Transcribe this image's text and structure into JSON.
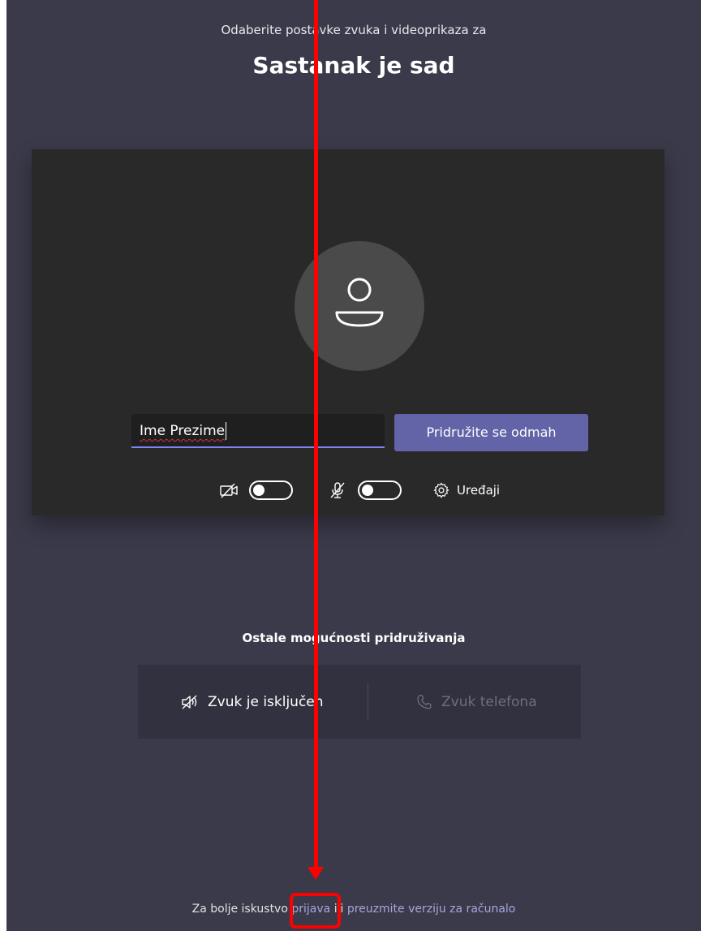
{
  "header": {
    "subtitle": "Odaberite postavke zvuka i videoprikaza za",
    "meeting_title": "Sastanak je sad"
  },
  "preview": {
    "avatar_icon": "person-icon",
    "name_value": "Ime Prezime",
    "join_button_label": "Pridružite se odmah"
  },
  "controls": {
    "camera_icon": "camera-off-icon",
    "camera_on": false,
    "mic_icon": "mic-off-icon",
    "mic_on": false,
    "devices_icon": "gear-icon",
    "devices_label": "Uređaji"
  },
  "other_options": {
    "heading": "Ostale mogućnosti pridruživanja",
    "audio_off_icon": "speaker-off-icon",
    "audio_off_label": "Zvuk je isključen",
    "phone_icon": "phone-icon",
    "phone_label": "Zvuk telefona"
  },
  "footer": {
    "prefix": "Za bolje iskustvo",
    "sign_in_link": "prijava",
    "connector": "ili",
    "download_link": "preuzmite verziju za računalo"
  },
  "annotation": {
    "color": "#ff0000"
  },
  "colors": {
    "background": "#3b3a4a",
    "preview_bg": "#292929",
    "accent": "#6264a7",
    "link": "#a6a7dc"
  }
}
